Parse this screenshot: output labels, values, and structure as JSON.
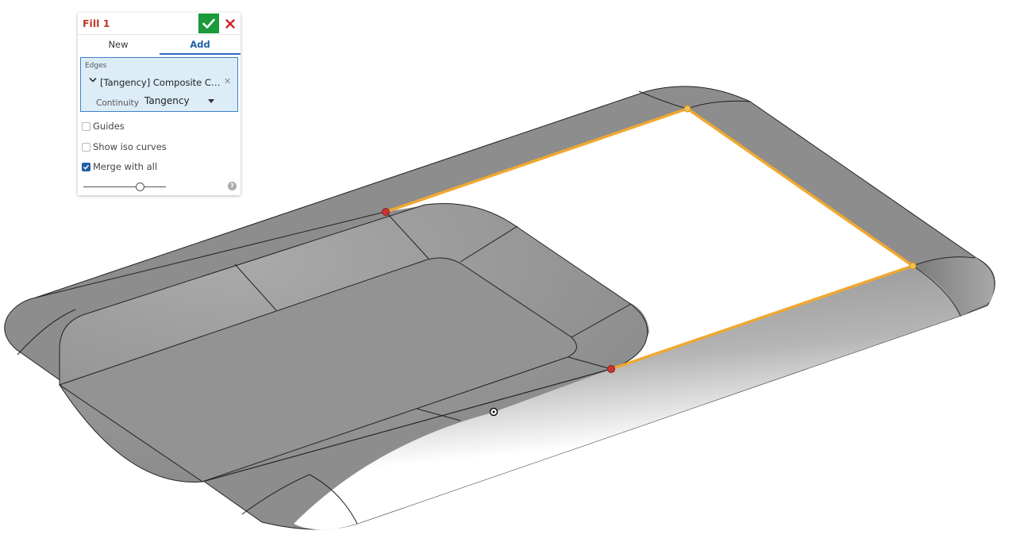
{
  "dialog": {
    "title": "Fill 1",
    "accept_icon": "checkmark-icon",
    "cancel_icon": "close-icon",
    "tabs": [
      {
        "label": "New",
        "active": false
      },
      {
        "label": "Add",
        "active": true
      }
    ],
    "edges": {
      "label": "Edges",
      "item": "[Tangency] Composite Cur...",
      "continuity_label": "Continuity",
      "continuity_value": "Tangency"
    },
    "options": [
      {
        "label": "Guides",
        "checked": false
      },
      {
        "label": "Show iso curves",
        "checked": false
      },
      {
        "label": "Merge with all",
        "checked": true
      }
    ],
    "slider_fraction": 0.68
  },
  "colors": {
    "accent": "#2a6cc0",
    "accept": "#1a9a3a",
    "cancel": "#d0202a",
    "title": "#c0392b",
    "selected_edge": "#f0a830",
    "vertex": "#cc3333",
    "model_gray": "#8f8f8f"
  }
}
